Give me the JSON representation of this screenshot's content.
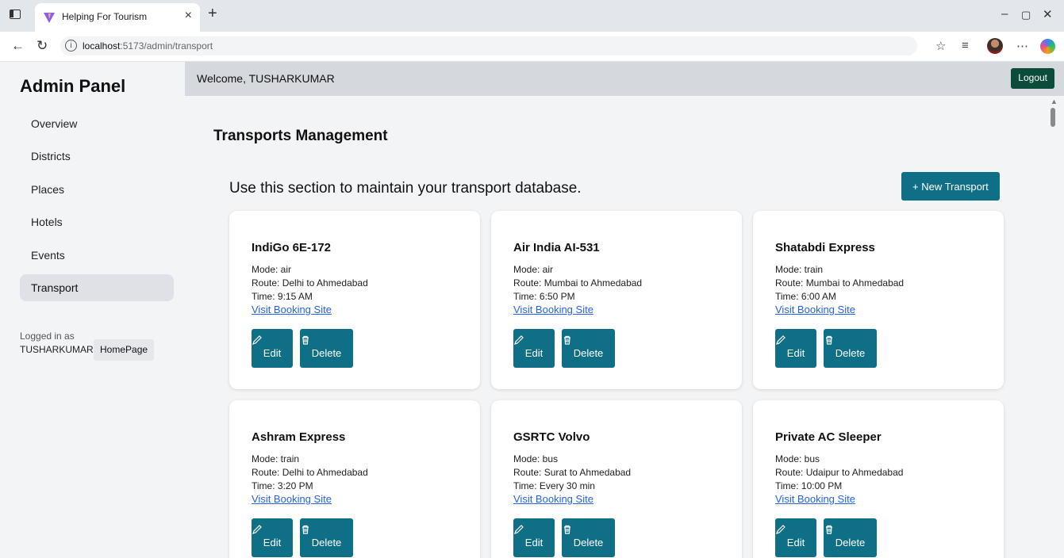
{
  "browser": {
    "tab_title": "Helping For Tourism",
    "url_host": "localhost",
    "url_path": ":5173/admin/transport"
  },
  "sidebar": {
    "title": "Admin Panel",
    "items": [
      {
        "label": "Overview"
      },
      {
        "label": "Districts"
      },
      {
        "label": "Places"
      },
      {
        "label": "Hotels"
      },
      {
        "label": "Events"
      },
      {
        "label": "Transport",
        "active": true
      }
    ],
    "logged_in_label": "Logged in as",
    "username": "TUSHARKUMAR",
    "homepage_button": "HomePage"
  },
  "header": {
    "welcome": "Welcome, TUSHARKUMAR",
    "logout": "Logout"
  },
  "main": {
    "title": "Transports Management",
    "description": "Use this section to maintain your transport database.",
    "new_button": "+ New Transport",
    "edit_label": "Edit",
    "delete_label": "Delete",
    "cards": [
      {
        "name": "IndiGo 6E-172",
        "mode": "Mode: air",
        "route": "Route: Delhi to Ahmedabad",
        "time": "Time: 9:15 AM",
        "link": "Visit Booking Site"
      },
      {
        "name": "Air India AI-531",
        "mode": "Mode: air",
        "route": "Route: Mumbai to Ahmedabad",
        "time": "Time: 6:50 PM",
        "link": "Visit Booking Site"
      },
      {
        "name": "Shatabdi Express",
        "mode": "Mode: train",
        "route": "Route: Mumbai to Ahmedabad",
        "time": "Time: 6:00 AM",
        "link": "Visit Booking Site"
      },
      {
        "name": "Ashram Express",
        "mode": "Mode: train",
        "route": "Route: Delhi to Ahmedabad",
        "time": "Time: 3:20 PM",
        "link": "Visit Booking Site"
      },
      {
        "name": "GSRTC Volvo",
        "mode": "Mode: bus",
        "route": "Route: Surat to Ahmedabad",
        "time": "Time: Every 30 min",
        "link": "Visit Booking Site"
      },
      {
        "name": "Private AC Sleeper",
        "mode": "Mode: bus",
        "route": "Route: Udaipur to Ahmedabad",
        "time": "Time: 10:00 PM",
        "link": "Visit Booking Site"
      }
    ]
  },
  "colors": {
    "accent": "#0f6f86",
    "logout": "#0b4d3a",
    "link": "#2563eb"
  }
}
